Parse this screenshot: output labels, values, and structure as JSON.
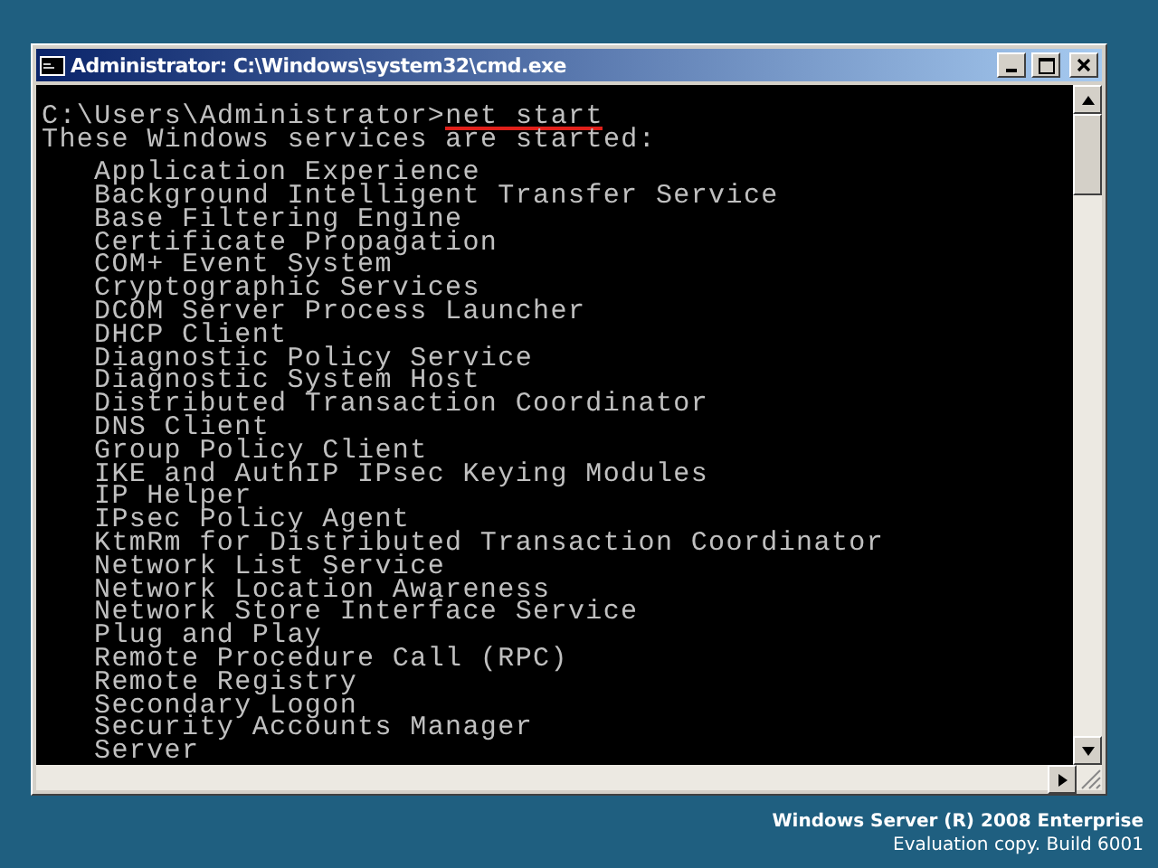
{
  "window": {
    "title": "Administrator: C:\\Windows\\system32\\cmd.exe"
  },
  "console": {
    "lines": [
      {
        "kind": "prompt",
        "prompt": "C:\\Users\\Administrator>",
        "command": "net start",
        "underlined": true
      },
      {
        "kind": "text",
        "text": "These Windows services are started:"
      },
      {
        "kind": "blank"
      },
      {
        "kind": "item",
        "text": "Application Experience"
      },
      {
        "kind": "item",
        "text": "Background Intelligent Transfer Service"
      },
      {
        "kind": "item",
        "text": "Base Filtering Engine"
      },
      {
        "kind": "item",
        "text": "Certificate Propagation"
      },
      {
        "kind": "item",
        "text": "COM+ Event System"
      },
      {
        "kind": "item",
        "text": "Cryptographic Services"
      },
      {
        "kind": "item",
        "text": "DCOM Server Process Launcher"
      },
      {
        "kind": "item",
        "text": "DHCP Client"
      },
      {
        "kind": "item",
        "text": "Diagnostic Policy Service"
      },
      {
        "kind": "item",
        "text": "Diagnostic System Host"
      },
      {
        "kind": "item",
        "text": "Distributed Transaction Coordinator"
      },
      {
        "kind": "item",
        "text": "DNS Client"
      },
      {
        "kind": "item",
        "text": "Group Policy Client"
      },
      {
        "kind": "item",
        "text": "IKE and AuthIP IPsec Keying Modules"
      },
      {
        "kind": "item",
        "text": "IP Helper"
      },
      {
        "kind": "item",
        "text": "IPsec Policy Agent"
      },
      {
        "kind": "item",
        "text": "KtmRm for Distributed Transaction Coordinator"
      },
      {
        "kind": "item",
        "text": "Network List Service"
      },
      {
        "kind": "item",
        "text": "Network Location Awareness"
      },
      {
        "kind": "item",
        "text": "Network Store Interface Service"
      },
      {
        "kind": "item",
        "text": "Plug and Play"
      },
      {
        "kind": "item",
        "text": "Remote Procedure Call (RPC)"
      },
      {
        "kind": "item",
        "text": "Remote Registry"
      },
      {
        "kind": "item",
        "text": "Secondary Logon"
      },
      {
        "kind": "item",
        "text": "Security Accounts Manager"
      },
      {
        "kind": "item",
        "text": "Server"
      }
    ]
  },
  "desktop": {
    "edition": "Windows Server (R) 2008 Enterprise",
    "build": "Evaluation copy. Build 6001"
  }
}
